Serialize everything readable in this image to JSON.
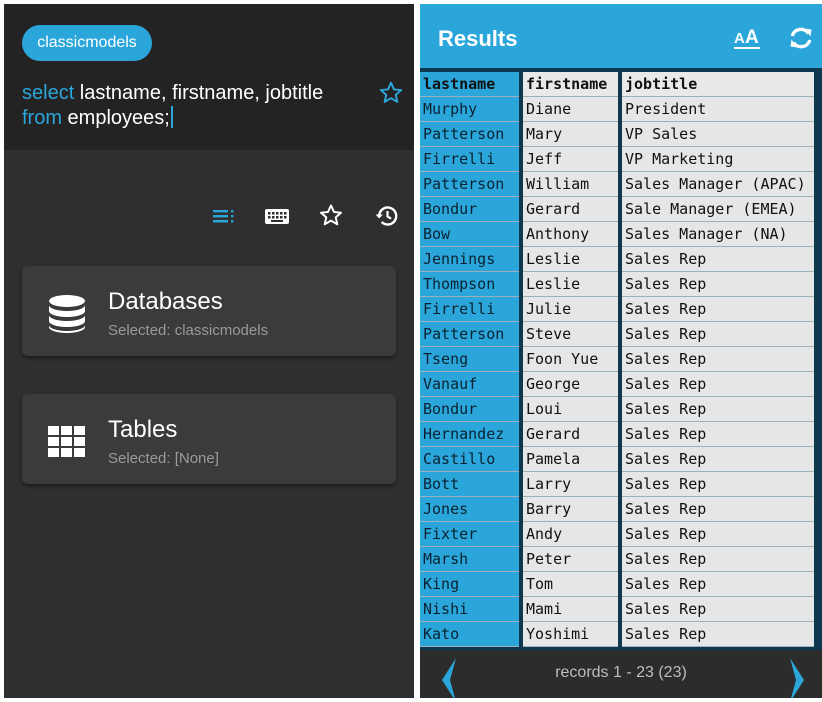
{
  "left": {
    "database_chip": "classicmodels",
    "sql": {
      "kw1": "select",
      "rest1": " lastname, firstname, jobtitle",
      "kw2": "from",
      "rest2": " employees;"
    },
    "toolbar_icons": [
      "list-icon",
      "keyboard-icon",
      "star-icon",
      "history-icon"
    ],
    "cards": [
      {
        "title": "Databases",
        "subtitle": "Selected: classicmodels",
        "icon": "database-icon"
      },
      {
        "title": "Tables",
        "subtitle": "Selected: [None]",
        "icon": "grid-icon"
      }
    ]
  },
  "results": {
    "title": "Results",
    "columns": [
      "lastname",
      "firstname",
      "jobtitle"
    ],
    "rows": [
      [
        "Murphy",
        "Diane",
        "President"
      ],
      [
        "Patterson",
        "Mary",
        "VP Sales"
      ],
      [
        "Firrelli",
        "Jeff",
        "VP Marketing"
      ],
      [
        "Patterson",
        "William",
        "Sales Manager (APAC)"
      ],
      [
        "Bondur",
        "Gerard",
        "Sale Manager (EMEA)"
      ],
      [
        "Bow",
        "Anthony",
        "Sales Manager (NA)"
      ],
      [
        "Jennings",
        "Leslie",
        "Sales Rep"
      ],
      [
        "Thompson",
        "Leslie",
        "Sales Rep"
      ],
      [
        "Firrelli",
        "Julie",
        "Sales Rep"
      ],
      [
        "Patterson",
        "Steve",
        "Sales Rep"
      ],
      [
        "Tseng",
        "Foon Yue",
        "Sales Rep"
      ],
      [
        "Vanauf",
        "George",
        "Sales Rep"
      ],
      [
        "Bondur",
        "Loui",
        "Sales Rep"
      ],
      [
        "Hernandez",
        "Gerard",
        "Sales Rep"
      ],
      [
        "Castillo",
        "Pamela",
        "Sales Rep"
      ],
      [
        "Bott",
        "Larry",
        "Sales Rep"
      ],
      [
        "Jones",
        "Barry",
        "Sales Rep"
      ],
      [
        "Fixter",
        "Andy",
        "Sales Rep"
      ],
      [
        "Marsh",
        "Peter",
        "Sales Rep"
      ],
      [
        "King",
        "Tom",
        "Sales Rep"
      ],
      [
        "Nishi",
        "Mami",
        "Sales Rep"
      ],
      [
        "Kato",
        "Yoshimi",
        "Sales Rep"
      ]
    ],
    "records_label": "records 1 - 23 (23)"
  },
  "colors": {
    "accent": "#2ba6da",
    "panel_dark": "#2f2f31",
    "editor_bg": "#232323",
    "card_bg": "#3b3b3d"
  }
}
